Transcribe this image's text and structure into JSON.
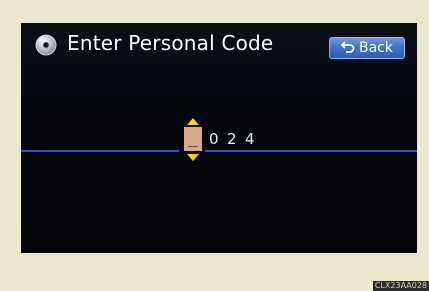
{
  "header": {
    "title": "Enter Personal Code",
    "back_label": "Back"
  },
  "code_entry": {
    "active_digit": "_",
    "digits": [
      "0",
      "2",
      "4"
    ]
  },
  "watermark": "CLX23AA028",
  "colors": {
    "background": "#ece8cf",
    "screen": "#05070c",
    "accent_button": "#3f72c4",
    "entry_line": "#3b55c0",
    "cursor_box": "#d9a787",
    "arrow": "#f2d21a"
  },
  "icons": {
    "title": "disc-icon",
    "back": "return-arrow-icon",
    "increase": "up-arrow-icon",
    "decrease": "down-arrow-icon"
  }
}
